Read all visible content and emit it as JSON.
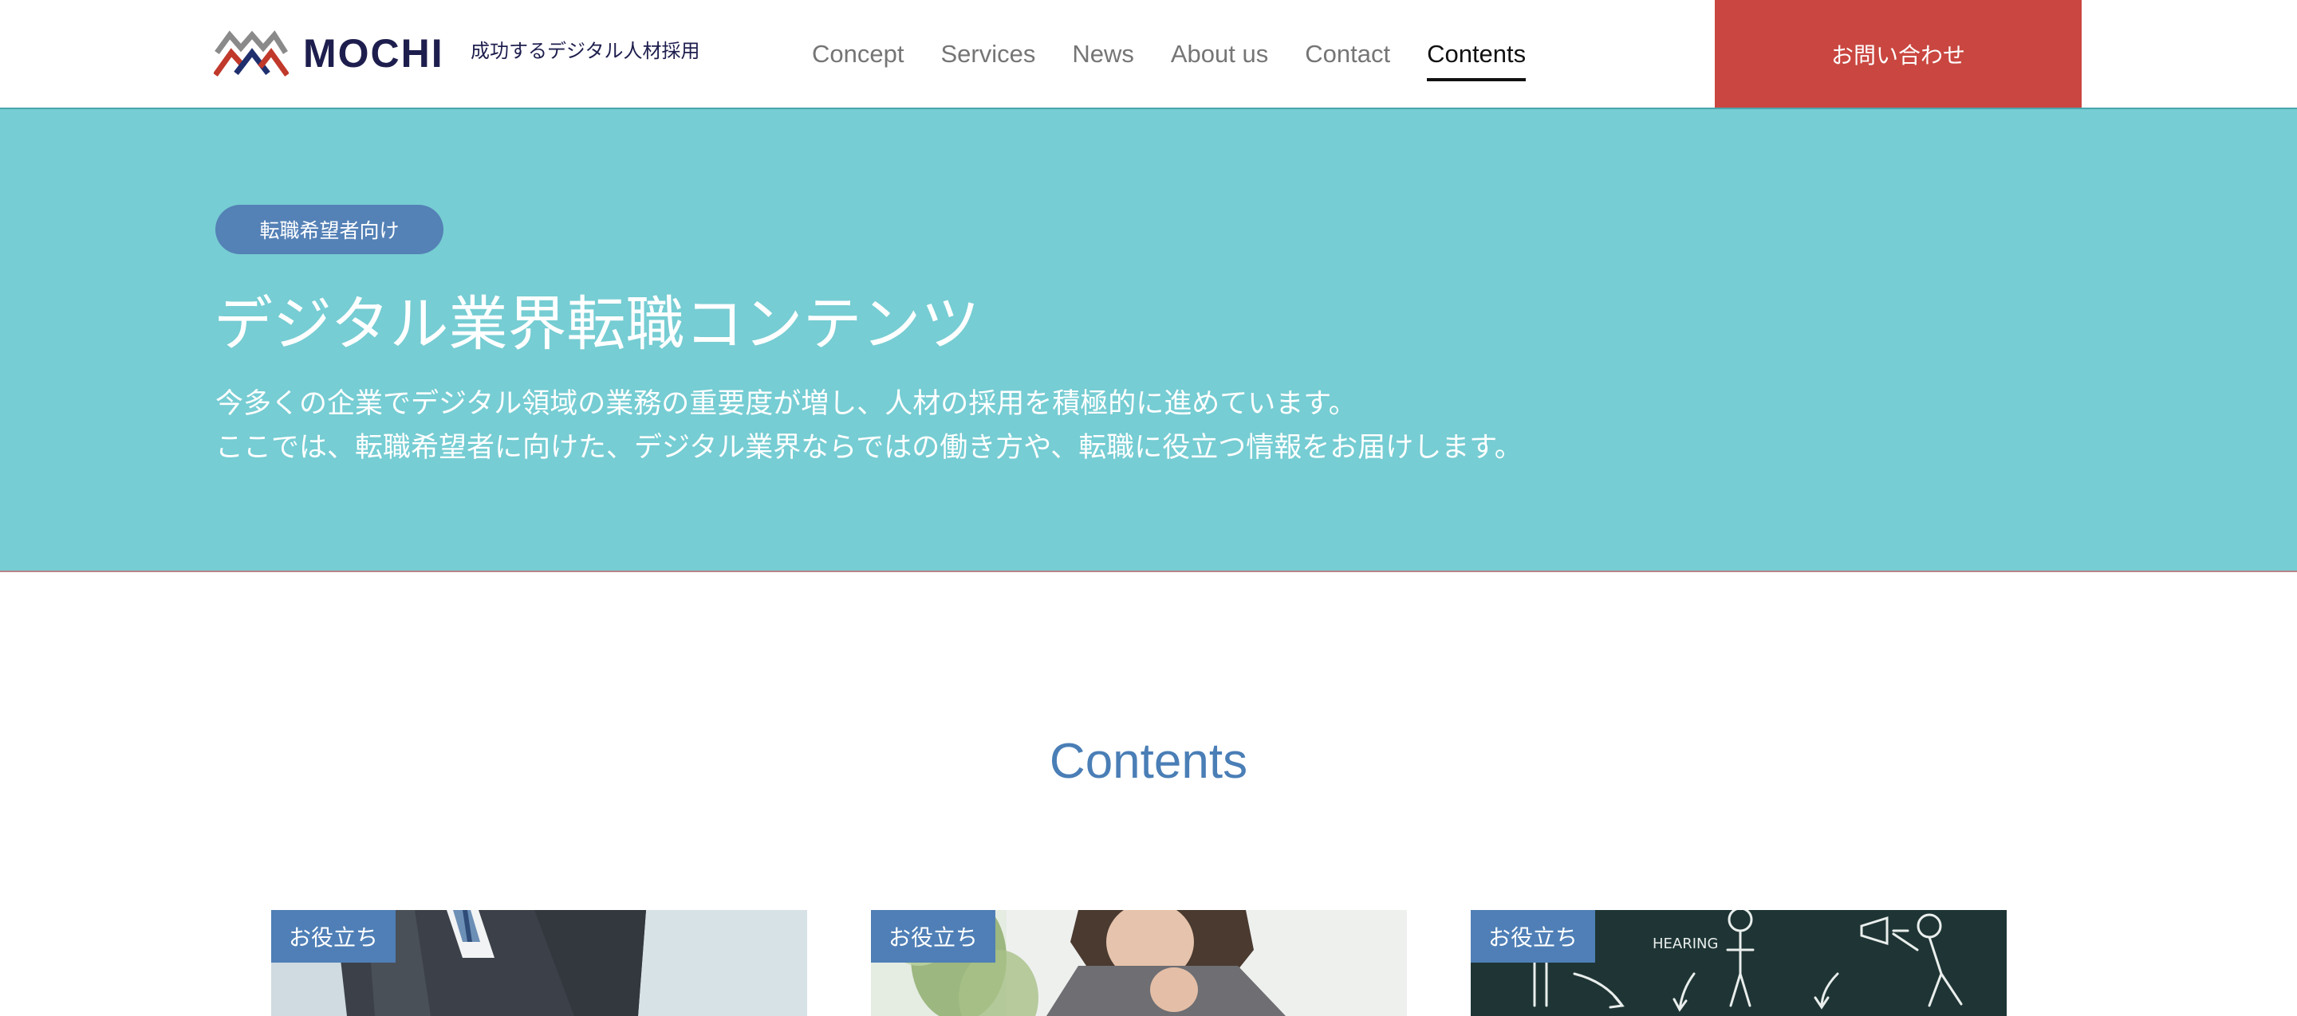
{
  "header": {
    "logo_text": "MOCHI",
    "tagline": "成功するデジタル人材採用",
    "nav": [
      {
        "label": "Concept"
      },
      {
        "label": "Services"
      },
      {
        "label": "News"
      },
      {
        "label": "About us"
      },
      {
        "label": "Contact"
      },
      {
        "label": "Contents",
        "active": true
      }
    ],
    "cta_label": "お問い合わせ"
  },
  "hero": {
    "badge": "転職希望者向け",
    "title": "デジタル業界転職コンテンツ",
    "description_line1": "今多くの企業でデジタル領域の業務の重要度が増し、人材の採用を積極的に進めています。",
    "description_line2": "ここでは、転職希望者に向けた、デジタル業界ならではの働き方や、転職に役立つ情報をお届けします。"
  },
  "contents": {
    "title": "Contents",
    "cards": [
      {
        "tag": "お役立ち",
        "image": "businessman-in-suit-photo"
      },
      {
        "tag": "お役立ち",
        "image": "woman-at-laptop-photo"
      },
      {
        "tag": "お役立ち",
        "image": "chalkboard-sketch-photo",
        "image_text": "HEARING"
      }
    ]
  },
  "colors": {
    "brand_navy": "#1e1e4e",
    "hero_teal": "#76cdd3",
    "cta_red": "#c94740",
    "accent_blue": "#4a7eb6"
  }
}
